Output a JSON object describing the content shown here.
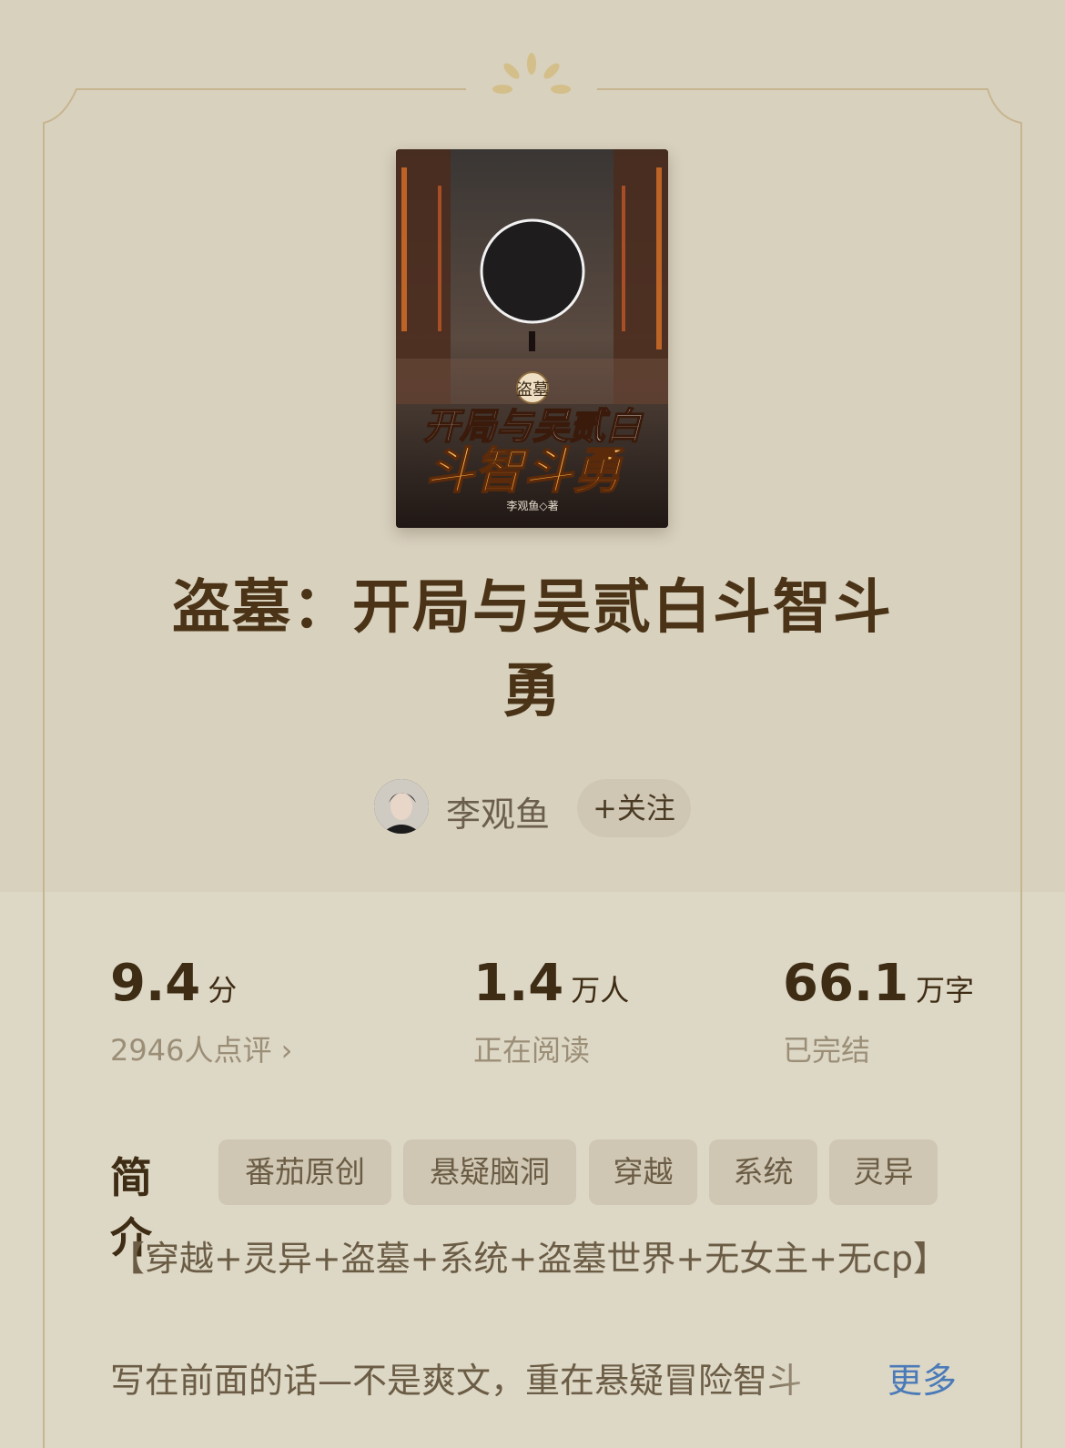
{
  "book": {
    "title": "盗墓：开局与吴贰白斗智斗勇",
    "cover": {
      "series_badge": "盗墓",
      "line1": "开局与吴贰白",
      "line2": "斗智斗勇",
      "author_credit": "李观鱼◇著"
    }
  },
  "author": {
    "name": "李观鱼",
    "follow_label": "+关注"
  },
  "stats": [
    {
      "value": "9.4",
      "unit": "分",
      "sub": "2946人点评 ›"
    },
    {
      "value": "1.4",
      "unit": "万人",
      "sub": "正在阅读"
    },
    {
      "value": "66.1",
      "unit": "万字",
      "sub": "已完结"
    }
  ],
  "intro": {
    "label": "简介",
    "tags": [
      "番茄原创",
      "悬疑脑洞",
      "穿越",
      "系统",
      "灵异"
    ],
    "description_line1": "【穿越+灵异+盗墓+系统+盗墓世界+无女主+无cp】",
    "description_line2": "写在前面的话—不是爽文，重在悬疑冒险智斗",
    "more_label": "更多"
  },
  "colors": {
    "background": "#d7d0bd",
    "title": "#4a3316",
    "link": "#4a7ab8",
    "tag_bg": "#cfc7b3"
  }
}
